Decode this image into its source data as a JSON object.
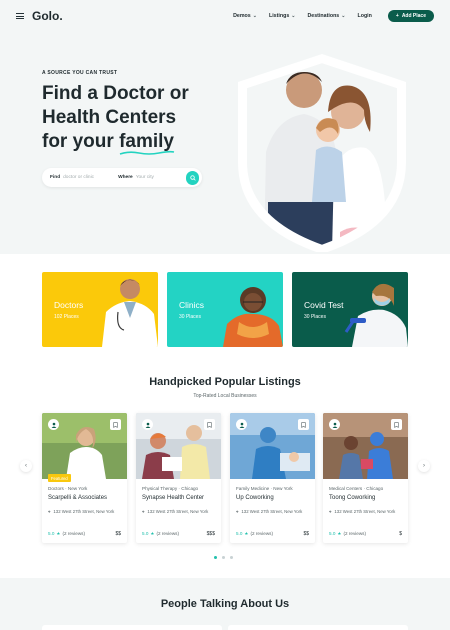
{
  "header": {
    "logo": "Golo.",
    "nav": [
      "Demos",
      "Listings",
      "Destinations"
    ],
    "login": "Login",
    "add_place": "Add Place"
  },
  "hero": {
    "eyebrow": "A SOURCE YOU CAN TRUST",
    "title_lines": [
      "Find a Doctor or",
      "Health Centers",
      "for your"
    ],
    "title_accent": "family",
    "search": {
      "find_label": "Find",
      "find_placeholder": "doctor or clinic",
      "where_label": "Where",
      "where_placeholder": "Your city"
    }
  },
  "categories": [
    {
      "title": "Doctors",
      "count": "102 Places",
      "color": "#fbc90a"
    },
    {
      "title": "Clinics",
      "count": "30 Places",
      "color": "#23d3c4"
    },
    {
      "title": "Covid Test",
      "count": "30 Places",
      "color": "#0a5c4b"
    }
  ],
  "listings": {
    "title": "Handpicked Popular Listings",
    "subtitle": "Top-Rated Local Businesses",
    "cards": [
      {
        "category": "Doctors",
        "city": "New York",
        "name": "Scarpelli & Associates",
        "address": "132 West 27th Street, New York",
        "score": "5.0",
        "star": "★",
        "reviews": "(2 reviews)",
        "price": "$$",
        "badge": "Featured"
      },
      {
        "category": "Physical Therapy",
        "city": "Chicago",
        "name": "Synapse Health Center",
        "address": "132 West 27th Street, New York",
        "score": "5.0",
        "star": "★",
        "reviews": "(2 reviews)",
        "price": "$$$",
        "badge": ""
      },
      {
        "category": "Family Medicine",
        "city": "New York",
        "name": "Up Coworking",
        "address": "132 West 27th Street, New York",
        "score": "5.0",
        "star": "★",
        "reviews": "(2 reviews)",
        "price": "$$",
        "badge": ""
      },
      {
        "category": "Medical Centers",
        "city": "Chicago",
        "name": "Toong Coworking",
        "address": "132 West 27th Street, New York",
        "score": "5.0",
        "star": "★",
        "reviews": "(2 reviews)",
        "price": "$",
        "badge": ""
      }
    ],
    "prev_icon": "‹",
    "next_icon": "›"
  },
  "testimonials": {
    "title": "People Talking About Us"
  },
  "colors": {
    "brand_dark": "#0a5c4b",
    "accent_teal": "#23d3c0",
    "accent_yellow": "#fbc90a"
  }
}
